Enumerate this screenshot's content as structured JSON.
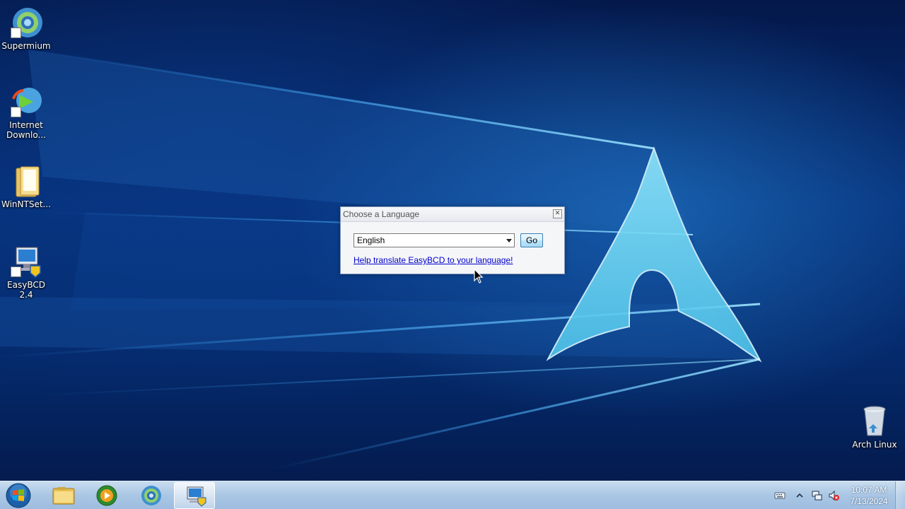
{
  "desktop": {
    "icons": [
      {
        "label": "Supermium",
        "icon": "supermium-icon"
      },
      {
        "label": "Internet Downlo...",
        "icon": "internet-download-manager-icon"
      },
      {
        "label": "WinNTSet...",
        "icon": "folder-icon"
      },
      {
        "label": "EasyBCD 2.4",
        "icon": "easybcd-icon"
      },
      {
        "label": "Arch Linux",
        "icon": "recycle-bin-icon"
      }
    ],
    "wallpaper": "arch-linux-logo-light-beams",
    "colors": {
      "accent": "#5fd4f4",
      "background": "#05307a"
    }
  },
  "dialog": {
    "title": "Choose a Language",
    "language_select": {
      "value": "English"
    },
    "go_label": "Go",
    "help_link": "Help translate EasyBCD to your language!"
  },
  "taskbar": {
    "start": "windows-start-orb",
    "pinned": [
      {
        "name": "file-explorer-icon"
      },
      {
        "name": "windows-media-player-icon"
      },
      {
        "name": "supermium-icon"
      },
      {
        "name": "easybcd-icon",
        "active": true
      }
    ],
    "tray": [
      "keyboard-icon",
      "show-hidden-icons-chevron",
      "network-icon",
      "volume-muted-icon"
    ],
    "clock": {
      "time": "10:07 AM",
      "date": "7/13/2024"
    }
  }
}
